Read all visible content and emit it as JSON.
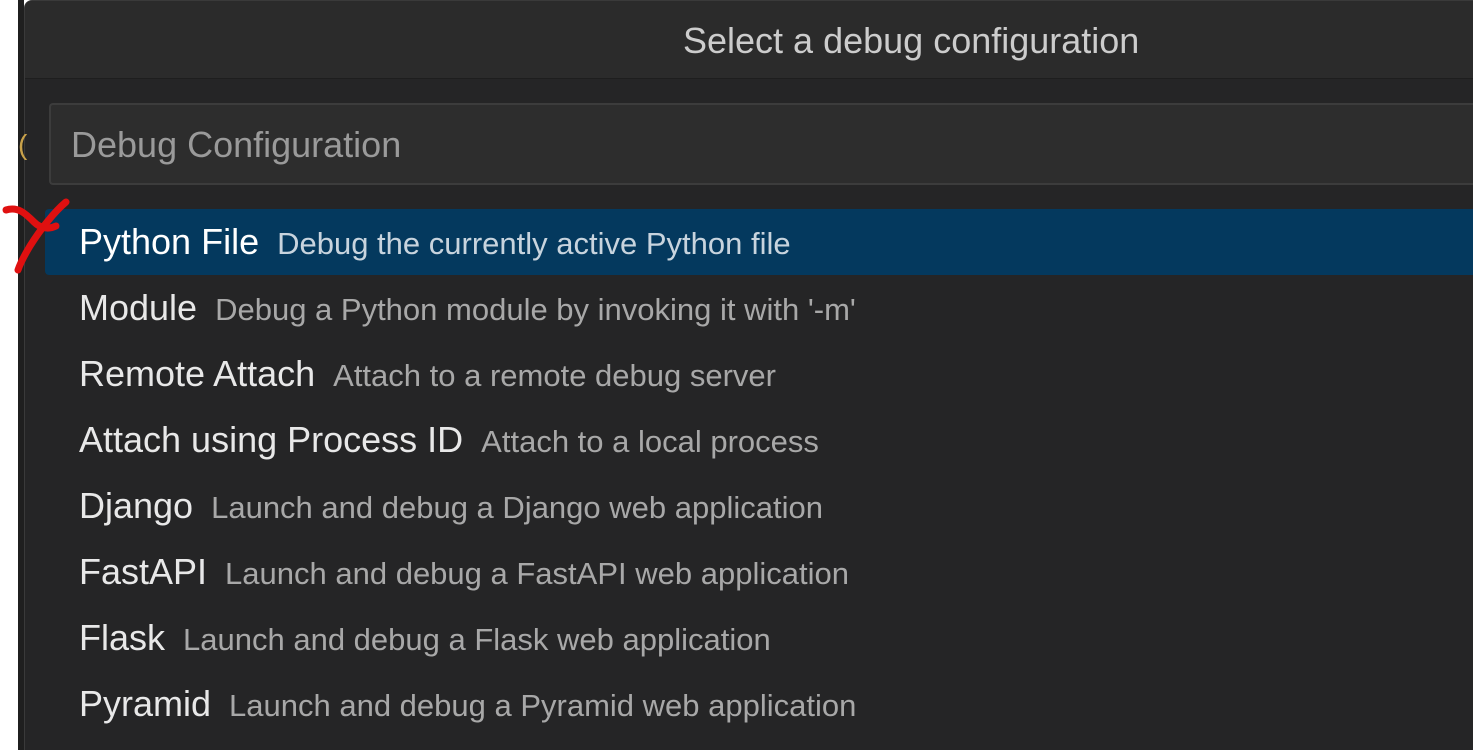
{
  "quick_pick": {
    "title": "Select a debug configuration",
    "input": {
      "placeholder": "Debug Configuration",
      "value": ""
    },
    "items": [
      {
        "label": "Python File",
        "description": "Debug the currently active Python file",
        "selected": true
      },
      {
        "label": "Module",
        "description": "Debug a Python module by invoking it with '-m'",
        "selected": false
      },
      {
        "label": "Remote Attach",
        "description": "Attach to a remote debug server",
        "selected": false
      },
      {
        "label": "Attach using Process ID",
        "description": "Attach to a local process",
        "selected": false
      },
      {
        "label": "Django",
        "description": "Launch and debug a Django web application",
        "selected": false
      },
      {
        "label": "FastAPI",
        "description": "Launch and debug a FastAPI web application",
        "selected": false
      },
      {
        "label": "Flask",
        "description": "Launch and debug a Flask web application",
        "selected": false
      },
      {
        "label": "Pyramid",
        "description": "Launch and debug a Pyramid web application",
        "selected": false
      }
    ]
  },
  "colors": {
    "panel_background": "#252526",
    "title_background": "#2b2b2b",
    "input_background": "#2d2d2d",
    "selected_background": "#04395e",
    "annotation_red": "#e01010"
  },
  "annotation": {
    "icon": "red-check-mark-annotation"
  }
}
